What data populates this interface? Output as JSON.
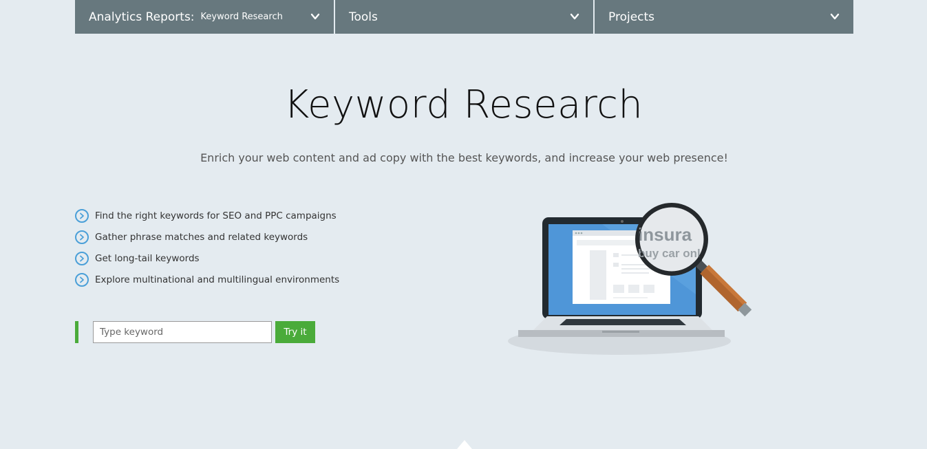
{
  "nav": {
    "items": [
      {
        "label": "Analytics Reports:",
        "sub": "Keyword Research"
      },
      {
        "label": "Tools"
      },
      {
        "label": "Projects"
      }
    ]
  },
  "hero": {
    "title": "Keyword Research",
    "subtitle": "Enrich your web content and ad copy with the best keywords, and increase your web presence!"
  },
  "features": [
    "Find the right keywords for SEO and PPC campaigns",
    "Gather phrase matches and related keywords",
    "Get long-tail keywords",
    "Explore multinational and multilingual environments"
  ],
  "search": {
    "placeholder": "Type keyword",
    "value": "",
    "button_label": "Try it"
  },
  "illustration": {
    "magnifier_text_1": "insura",
    "magnifier_text_2": "buy car onl"
  },
  "colors": {
    "nav_bg": "#67787e",
    "page_bg": "#e4ebf0",
    "accent_green": "#4aab3a",
    "bullet_blue": "#4a9fd8"
  }
}
